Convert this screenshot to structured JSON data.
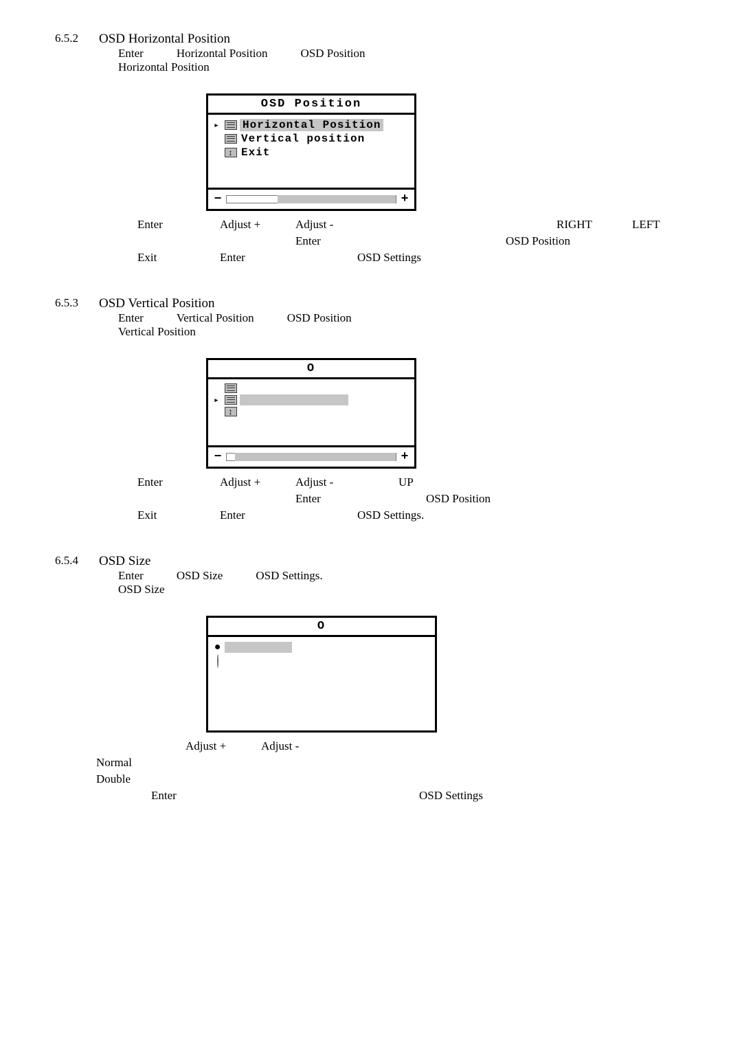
{
  "s652": {
    "num": "6.5.2",
    "title": "OSD Horizontal Position",
    "instr": {
      "enter": "Enter",
      "label1": "Horizontal Position",
      "label2": "OSD Position",
      "line2": "Horizontal Position"
    },
    "panel": {
      "title": "OSD Position",
      "item1": "Horizontal Position",
      "item2": "Vertical position",
      "item3": "Exit"
    },
    "under": {
      "r1": {
        "a": "Enter",
        "b": "Adjust +",
        "c": "Adjust -",
        "e": "RIGHT",
        "f": "LEFT"
      },
      "r2": {
        "c": "Enter",
        "d": "OSD Position"
      },
      "r3": {
        "a": "Exit",
        "b": "Enter",
        "d": "OSD Settings"
      }
    }
  },
  "s653": {
    "num": "6.5.3",
    "title": "OSD Vertical Position",
    "instr": {
      "enter": "Enter",
      "label1": "Vertical Position",
      "label2": "OSD Position",
      "line2": "Vertical Position"
    },
    "panel": {
      "title": "O"
    },
    "under": {
      "r1": {
        "a": "Enter",
        "b": "Adjust +",
        "c": "Adjust -",
        "d": "UP"
      },
      "r2": {
        "c": "Enter",
        "d": "OSD Position"
      },
      "r3": {
        "a": "Exit",
        "b": "Enter",
        "d": "OSD Settings."
      }
    }
  },
  "s654": {
    "num": "6.5.4",
    "title": "OSD Size",
    "instr": {
      "enter": "Enter",
      "label1": "OSD Size",
      "label2": "OSD Settings.",
      "line2": "OSD Size"
    },
    "panel": {
      "title": "O"
    },
    "under": {
      "r1": {
        "b": "Adjust +",
        "c": "Adjust -"
      },
      "r2": {
        "a": "Normal"
      },
      "r3": {
        "a": "Double"
      },
      "r4": {
        "a": "Enter",
        "d": "OSD Settings"
      }
    }
  }
}
